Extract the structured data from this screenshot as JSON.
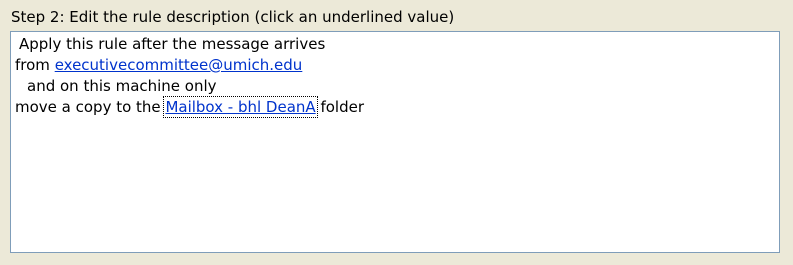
{
  "step2": {
    "label": "Step 2: Edit the rule description (click an underlined value)"
  },
  "rule": {
    "line1": "Apply this rule after the message arrives",
    "line2_prefix": "from ",
    "line2_link": "executivecommittee@umich.edu",
    "line3": "and on this machine only",
    "line4_prefix": "move a copy to the ",
    "line4_link": "Mailbox - bhl DeanA",
    "line4_suffix": " folder"
  },
  "colors": {
    "background": "#ECE9D8",
    "box_border": "#7F9DB9",
    "link": "#0033CC"
  }
}
